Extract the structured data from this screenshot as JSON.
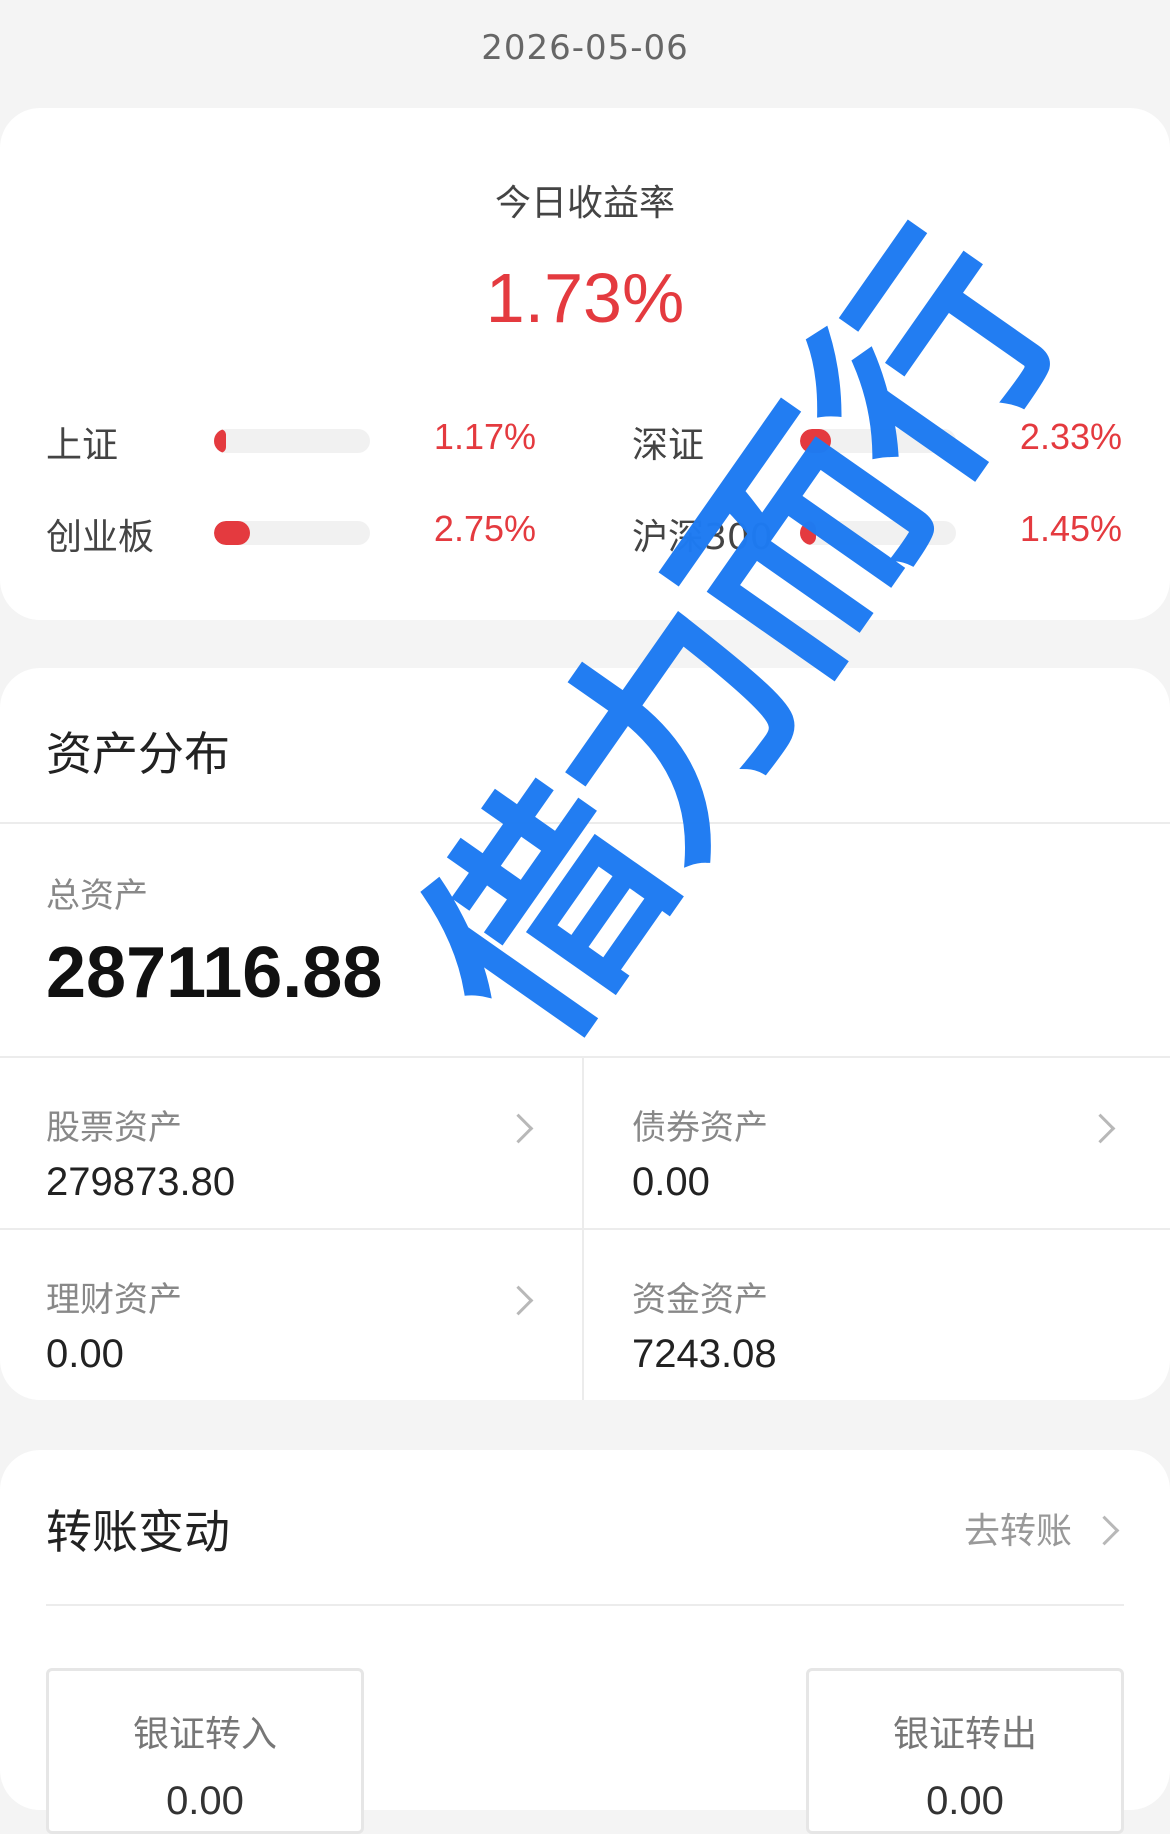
{
  "header": {
    "date": "2026-05-06"
  },
  "returns": {
    "label": "今日收益率",
    "value": "1.73%",
    "accent_color": "#e43a3f",
    "indices": [
      {
        "name": "上证",
        "pct": "1.17%",
        "bar_fraction": 0.08
      },
      {
        "name": "深证",
        "pct": "2.33%",
        "bar_fraction": 0.2
      },
      {
        "name": "创业板",
        "pct": "2.75%",
        "bar_fraction": 0.23
      },
      {
        "name": "沪深300",
        "pct": "1.45%",
        "bar_fraction": 0.1
      }
    ]
  },
  "assets": {
    "title": "资产分布",
    "total_label": "总资产",
    "total_value": "287116.88",
    "items": [
      {
        "label": "股票资产",
        "value": "279873.80",
        "has_chevron": true
      },
      {
        "label": "债券资产",
        "value": "0.00",
        "has_chevron": true
      },
      {
        "label": "理财资产",
        "value": "0.00",
        "has_chevron": true
      },
      {
        "label": "资金资产",
        "value": "7243.08",
        "has_chevron": false
      }
    ]
  },
  "transfer": {
    "title": "转账变动",
    "link_label": "去转账",
    "bank_in_label": "银证转入",
    "bank_in_value": "0.00",
    "bank_out_label": "银证转出",
    "bank_out_value": "0.00"
  },
  "watermark": {
    "text": "借力而行",
    "color": "#1e7bf2"
  }
}
